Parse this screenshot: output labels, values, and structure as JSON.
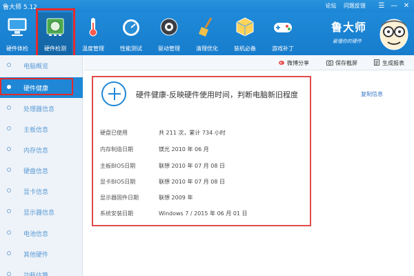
{
  "app": {
    "title": "鲁大师 5.12"
  },
  "titlebar": {
    "links": [
      "论坛",
      "问题反馈"
    ],
    "controls": [
      "☰",
      "—",
      "✕"
    ]
  },
  "toolbar": {
    "items": [
      {
        "label": "硬件体检",
        "icon": "computer-check-icon"
      },
      {
        "label": "硬件检测",
        "icon": "hardware-board-icon",
        "active": true
      },
      {
        "label": "温度管理",
        "icon": "thermometer-icon"
      },
      {
        "label": "性能测试",
        "icon": "speedometer-icon"
      },
      {
        "label": "驱动管理",
        "icon": "gear-icon"
      },
      {
        "label": "清理优化",
        "icon": "broom-icon"
      },
      {
        "label": "装机必备",
        "icon": "cube-package-icon"
      },
      {
        "label": "游戏补丁",
        "icon": "gamepad-icon"
      }
    ]
  },
  "brand": {
    "name": "鲁大师",
    "slogan": "最懂你的硬件"
  },
  "sidebar": {
    "items": [
      {
        "label": "电脑概览"
      },
      {
        "label": "硬件健康",
        "active": true
      },
      {
        "label": "处理器信息"
      },
      {
        "label": "主板信息"
      },
      {
        "label": "内存信息"
      },
      {
        "label": "硬盘信息"
      },
      {
        "label": "显卡信息"
      },
      {
        "label": "显示器信息"
      },
      {
        "label": "电池信息"
      },
      {
        "label": "其他硬件"
      },
      {
        "label": "功耗估算"
      }
    ]
  },
  "actions": {
    "share": "微博分享",
    "save": "保存截屏",
    "report": "生成报表"
  },
  "card": {
    "title": "硬件健康-反映硬件使用时间，判断电脑新旧程度",
    "rows": [
      {
        "key": "硬盘已使用",
        "value": "共 211 次，累计 734 小时"
      },
      {
        "key": "内存制造日期",
        "value": "镁光 2010 年 06 月"
      },
      {
        "key": "主板BIOS日期",
        "value": "联想 2010 年 07 月 08 日"
      },
      {
        "key": "显卡BIOS日期",
        "value": "联想 2010 年 07 月 08 日"
      },
      {
        "key": "显示器固件日期",
        "value": "联想 2009 年"
      },
      {
        "key": "系统安装日期",
        "value": "Windows 7 / 2015 年 06 月 01 日"
      }
    ]
  },
  "copy": {
    "label": "复制信息"
  },
  "colors": {
    "primary": "#1f87d6",
    "highlight_red": "#e52a2a"
  }
}
